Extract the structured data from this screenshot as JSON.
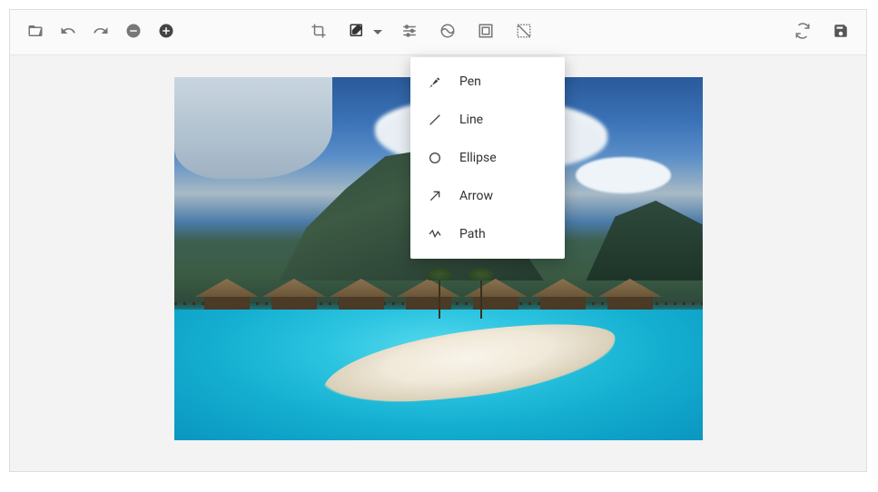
{
  "dropdown": {
    "items": [
      {
        "label": "Pen"
      },
      {
        "label": "Line"
      },
      {
        "label": "Ellipse"
      },
      {
        "label": "Arrow"
      },
      {
        "label": "Path"
      }
    ]
  }
}
